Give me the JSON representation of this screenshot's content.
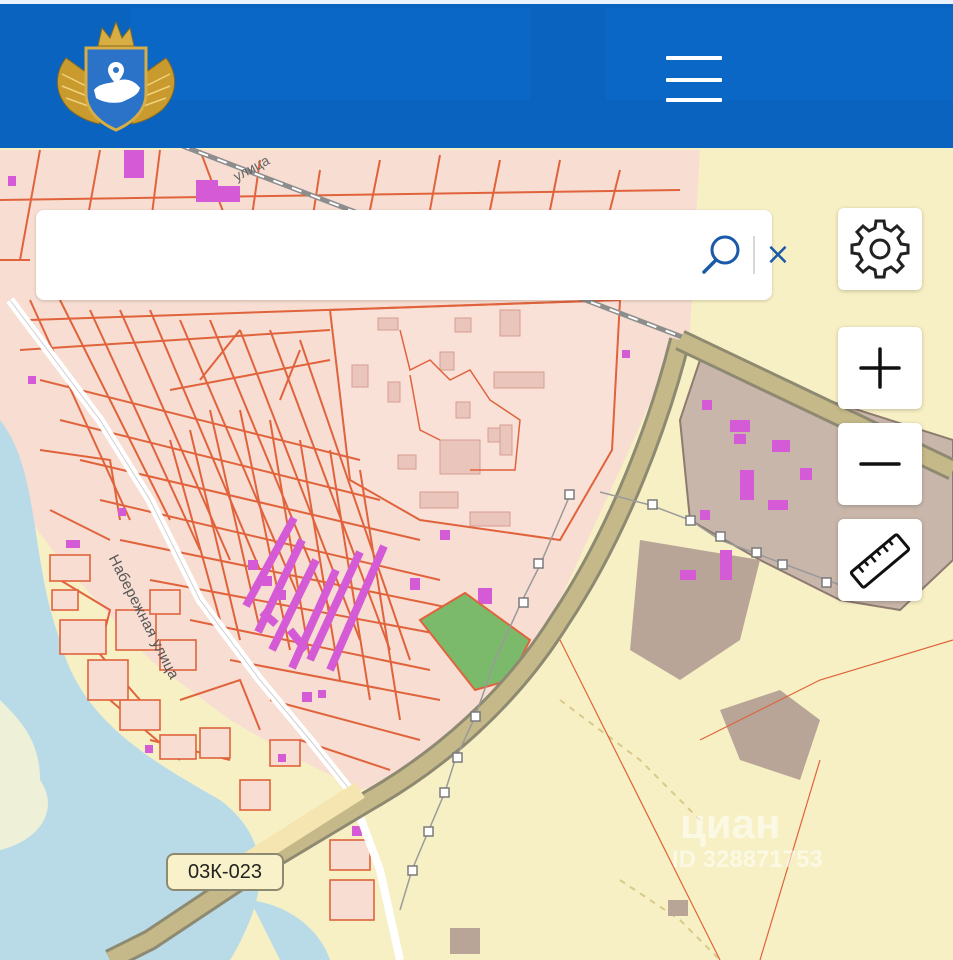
{
  "header": {
    "logo_icon": "winged-shield-russia-map-logo-icon",
    "menu_icon": "hamburger-menu-icon",
    "background": "#0a63bf"
  },
  "search": {
    "value": "",
    "placeholder": "",
    "search_icon": "magnifier-icon",
    "clear_label": "×"
  },
  "controls": {
    "settings_icon": "gear-icon",
    "zoom_in_icon": "plus-icon",
    "zoom_out_icon": "minus-icon",
    "measure_icon": "ruler-icon"
  },
  "map": {
    "road_label": "03К-023",
    "street_label": "Набережная улица",
    "street_label_top": "улица",
    "watermark_brand": "циан",
    "watermark_id": "ID 328871753",
    "colors": {
      "background": "#f7f0c4",
      "parcel_fill": "#f7ddd2",
      "parcel_stroke": "#e0633c",
      "building": "#d55bd6",
      "river": "#b9dbe8",
      "highway": "#c5b889",
      "green_parcel": "#7cba6b",
      "industrial": "#b9a598"
    }
  }
}
